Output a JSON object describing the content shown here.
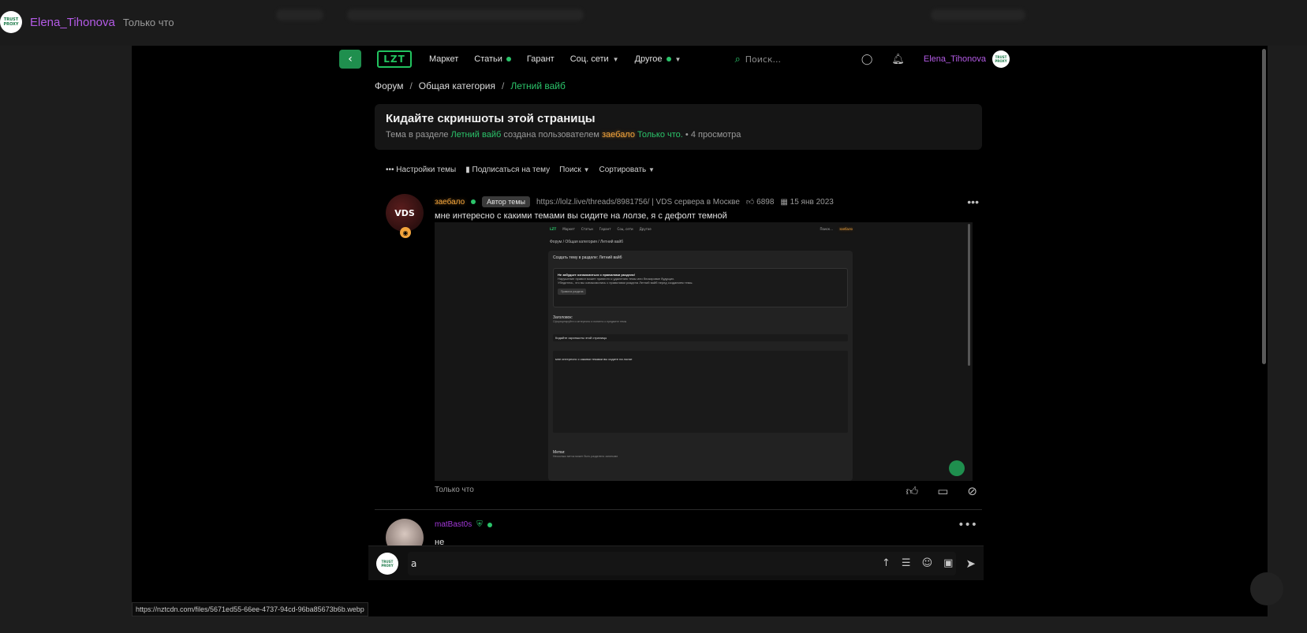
{
  "lightbox": {
    "username": "Elena_Tihonova",
    "time": "Только что",
    "avatar_text": "TRUST PROXY"
  },
  "nav": {
    "back": "‹",
    "logo": "LZT",
    "links": [
      {
        "label": "Маркет",
        "dot": false,
        "chevron": false
      },
      {
        "label": "Статьи",
        "dot": true,
        "chevron": false
      },
      {
        "label": "Гарант",
        "dot": false,
        "chevron": false
      },
      {
        "label": "Соц. сети",
        "dot": false,
        "chevron": true
      },
      {
        "label": "Другое",
        "dot": true,
        "chevron": true
      }
    ],
    "search_placeholder": "Поиск...",
    "user": "Elena_Tihonova"
  },
  "breadcrumb": {
    "items": [
      "Форум",
      "Общая категория",
      "Летний вайб"
    ],
    "separator": "/"
  },
  "topic": {
    "title": "Кидайте скриншоты этой страницы",
    "meta_prefix": "Тема в разделе",
    "meta_section": "Летний вайб",
    "meta_mid": "создана пользователем",
    "meta_author": "заебало",
    "meta_time": "Только что.",
    "meta_views": "• 4 просмотра"
  },
  "tools": {
    "settings": "Настройки темы",
    "subscribe": "Подписаться на тему",
    "search": "Поиск",
    "sort": "Сортировать"
  },
  "post": {
    "author": "заебало",
    "author_tag": "Автор темы",
    "avatar_text": "VDS",
    "link": "https://lolz.live/threads/8981756/ | VDS сервера в Москве",
    "likes": "6898",
    "date": "15 янв 2023",
    "text": "мне интересно с какими темами вы сидите на лолзе, я с дефолт темной",
    "time": "Только что",
    "image": {
      "crumb": "Форум / Общая категория / Летний вайб",
      "panel_title": "Создать тему в разделе: Летний вайб",
      "rules_title": "Не забудьте ознакомиться с правилами раздела!",
      "rules_line1": "Нарушение правил может привести к удалению темы или блокировке будущих.",
      "rules_line2": "Убедитесь, что вы ознакомились с правилами раздела Летний вайб перед созданием темы.",
      "rules_button": "Правила раздела",
      "title_label": "Заголовок:",
      "title_hint": "Сформулируйте и интересно и понятно о предмете темы",
      "title_value": "Кидайте скриншоты этой страницы",
      "editor_text": "мне интересно с какими темами вы сидите на лолзе",
      "tags_label": "Метки:",
      "tags_hint": "Несколько меток может быть разделено запятыми"
    }
  },
  "reply": {
    "author": "matBast0s",
    "text": "не"
  },
  "composer": {
    "value": "a",
    "avatar_text": "TRUST PROXY"
  },
  "status_url": "https://nztcdn.com/files/5671ed55-66ee-4737-94cd-96ba85673b6b.webp"
}
